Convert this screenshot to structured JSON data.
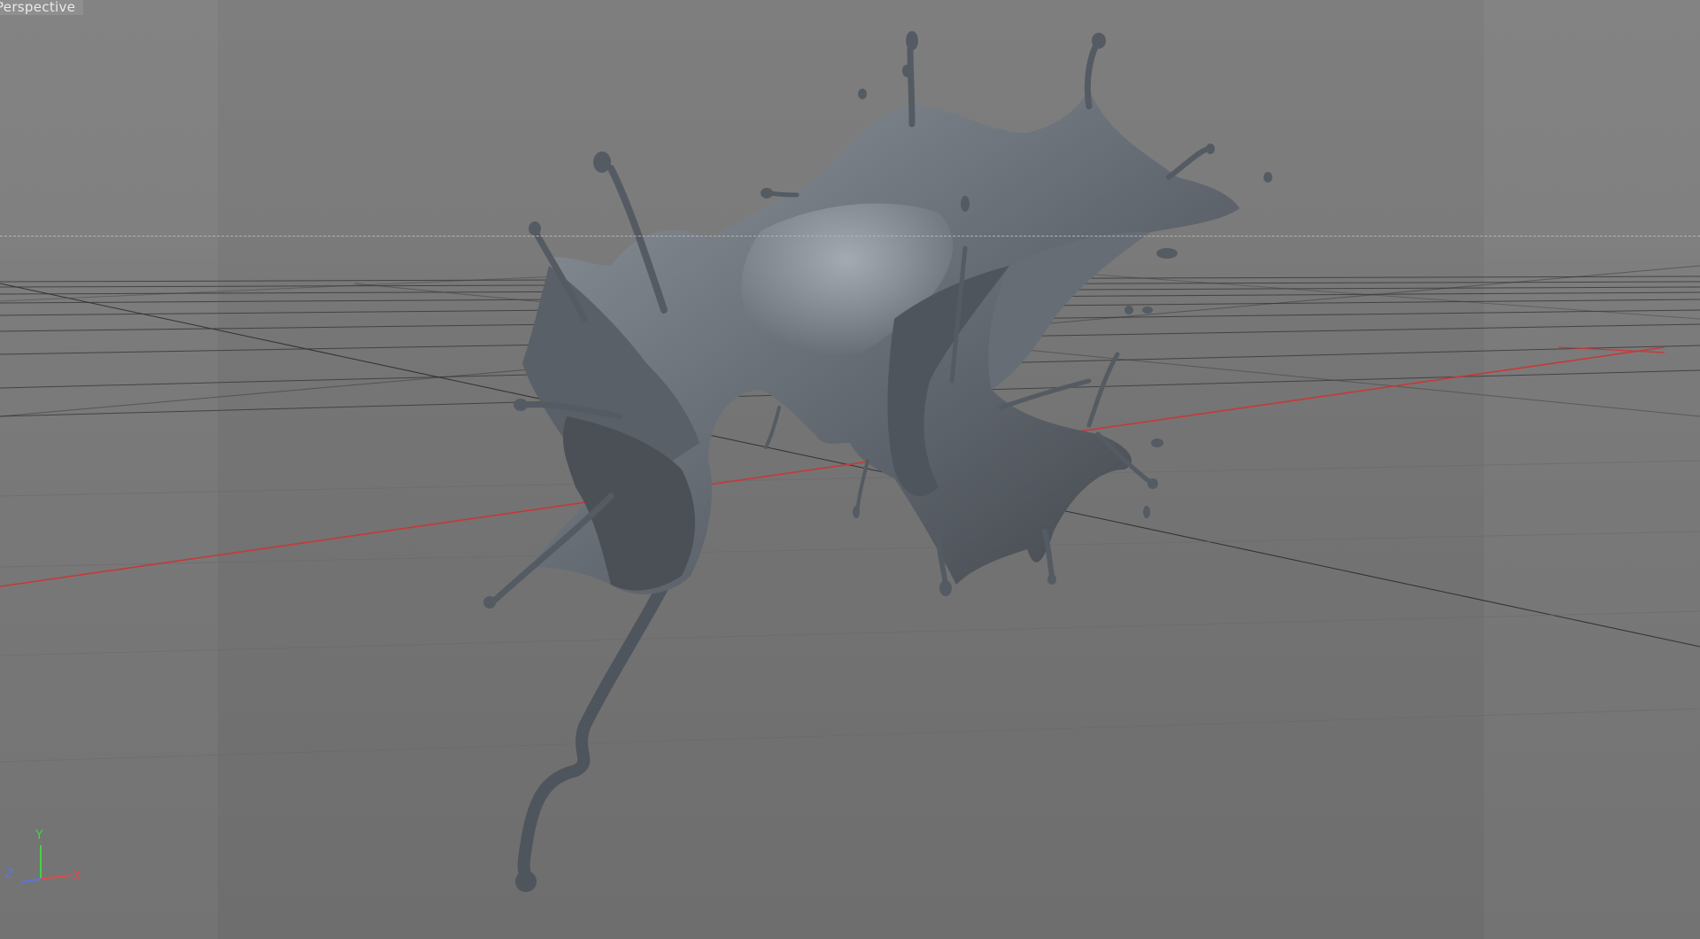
{
  "viewport": {
    "label": "Perspective",
    "background": "#737373",
    "grid_color": "#2a2a2a",
    "x_axis_color": "#c83838",
    "fluid_color": "#5b6168"
  },
  "axis_gizmo": {
    "y": "Y",
    "x": "X",
    "z": "Z",
    "y_color": "#44d244",
    "x_color": "#e04a4a",
    "z_color": "#5a74e6"
  }
}
